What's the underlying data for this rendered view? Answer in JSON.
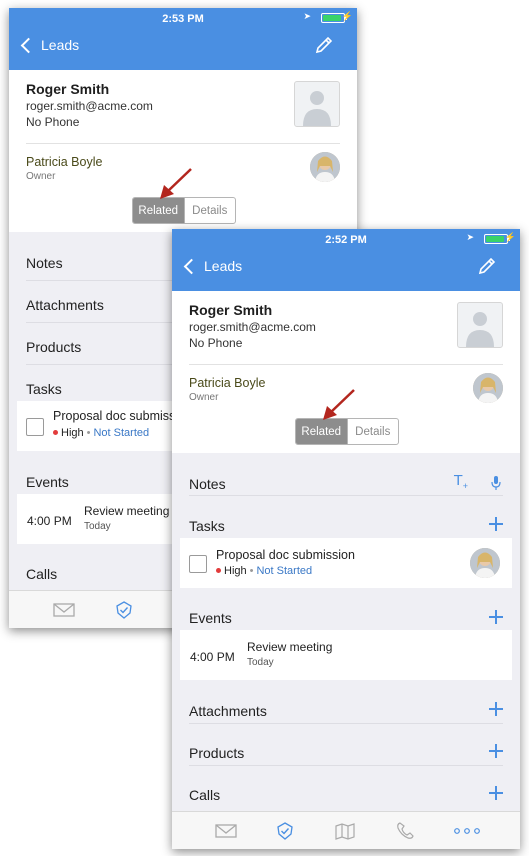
{
  "back_screen": {
    "status_time": "2:53 PM",
    "nav": {
      "back_label": "Leads"
    },
    "contact": {
      "name": "Roger Smith",
      "email": "roger.smith@acme.com",
      "phone": "No Phone"
    },
    "owner": {
      "name": "Patricia Boyle",
      "label": "Owner"
    },
    "segment": {
      "related": "Related",
      "details": "Details"
    },
    "sections": {
      "notes": "Notes",
      "attachments": "Attachments",
      "products": "Products",
      "tasks": "Tasks",
      "events": "Events",
      "calls": "Calls"
    },
    "task": {
      "title": "Proposal doc submission",
      "priority": "High",
      "status": "Not Started"
    },
    "event": {
      "time": "4:00 PM",
      "title": "Review meeting",
      "day": "Today"
    }
  },
  "front_screen": {
    "status_time": "2:52 PM",
    "nav": {
      "back_label": "Leads"
    },
    "contact": {
      "name": "Roger Smith",
      "email": "roger.smith@acme.com",
      "phone": "No Phone"
    },
    "owner": {
      "name": "Patricia Boyle",
      "label": "Owner"
    },
    "segment": {
      "related": "Related",
      "details": "Details"
    },
    "sections": {
      "notes": "Notes",
      "tasks": "Tasks",
      "events": "Events",
      "attachments": "Attachments",
      "products": "Products",
      "calls": "Calls"
    },
    "task": {
      "title": "Proposal doc submission",
      "priority": "High",
      "status": "Not Started"
    },
    "event": {
      "time": "4:00 PM",
      "title": "Review meeting",
      "day": "Today"
    },
    "tabs": [
      "mail-icon",
      "checkmark-shield-icon",
      "map-icon",
      "phone-icon",
      "more-icon"
    ]
  },
  "colors": {
    "accent": "#4a8fe2",
    "priority_dot": "#e23b3b",
    "annotation_arrow": "#b3261e",
    "segment_selected": "#8d8d8d"
  }
}
